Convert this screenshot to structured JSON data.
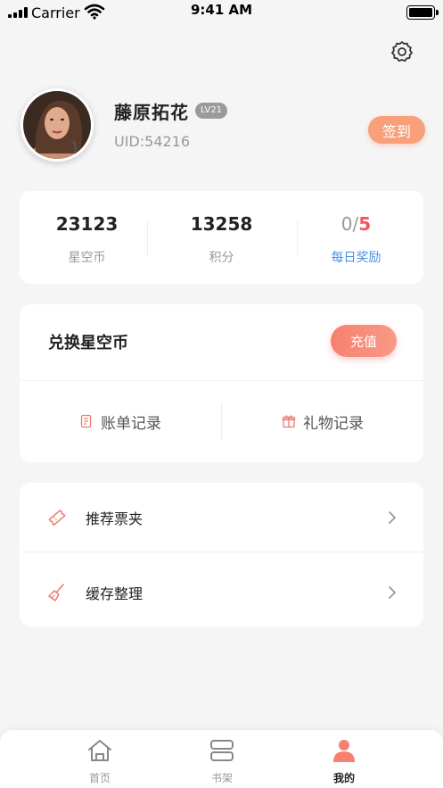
{
  "status_bar": {
    "carrier": "Carrier",
    "time": "9:41 AM"
  },
  "profile": {
    "name": "藤原拓花",
    "level": "LV21",
    "uid": "UID:54216",
    "checkin_label": "签到"
  },
  "stats": [
    {
      "value": "23123",
      "label": "星空币"
    },
    {
      "value": "13258",
      "label": "积分"
    },
    {
      "current": "0",
      "separator": "/",
      "total": "5",
      "label": "每日奖励"
    }
  ],
  "exchange": {
    "title": "兑换星空币",
    "recharge_label": "充值",
    "bill_label": "账单记录",
    "gift_label": "礼物记录"
  },
  "menu": [
    {
      "label": "推荐票夹",
      "icon": "ticket-icon"
    },
    {
      "label": "缓存整理",
      "icon": "broom-icon"
    }
  ],
  "tabs": [
    {
      "label": "首页",
      "icon": "home-icon"
    },
    {
      "label": "书架",
      "icon": "bookshelf-icon"
    },
    {
      "label": "我的",
      "icon": "user-icon",
      "active": true
    }
  ],
  "colors": {
    "accent": "#f7806e",
    "checkin": "#f7a07a",
    "reward_highlight": "#f0595e",
    "link_blue": "#4a90e2"
  }
}
